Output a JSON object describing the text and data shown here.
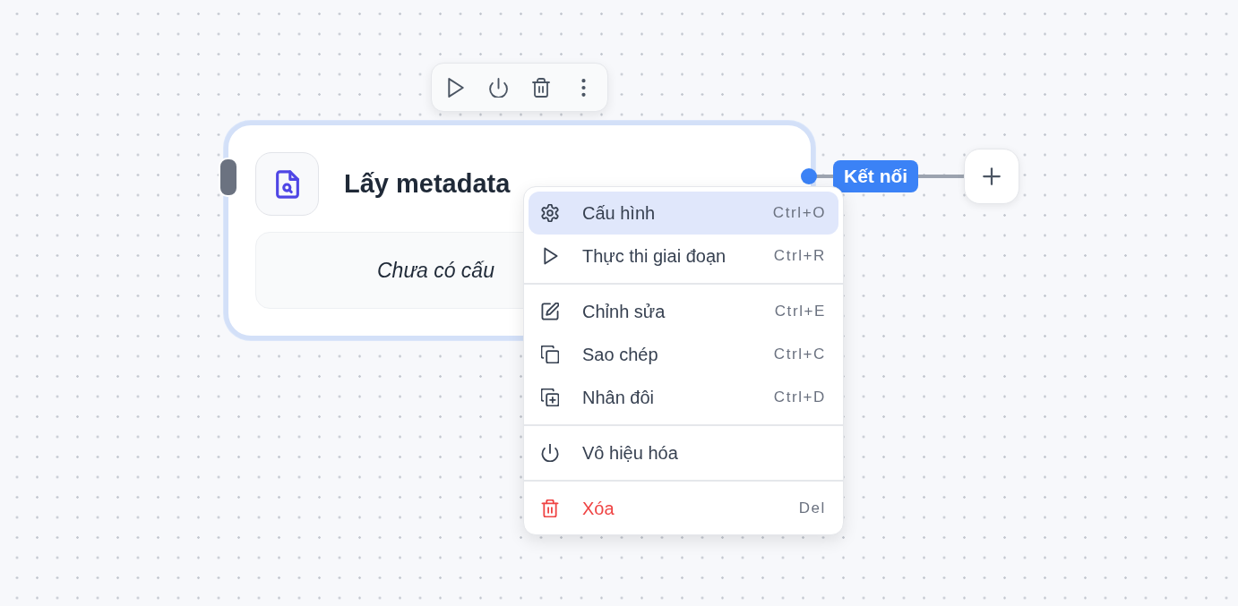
{
  "node": {
    "title": "Lấy metadata",
    "description": "Chưa có cấu",
    "selected": true
  },
  "edge": {
    "label": "Kết nối"
  },
  "context_menu": {
    "groups": [
      {
        "items": [
          {
            "label": "Cấu hình",
            "shortcut": "Ctrl+O",
            "selected": true,
            "danger": false
          },
          {
            "label": "Thực thi giai đoạn",
            "shortcut": "Ctrl+R",
            "selected": false,
            "danger": false
          }
        ]
      },
      {
        "items": [
          {
            "label": "Chỉnh sửa",
            "shortcut": "Ctrl+E",
            "selected": false,
            "danger": false
          },
          {
            "label": "Sao chép",
            "shortcut": "Ctrl+C",
            "selected": false,
            "danger": false
          },
          {
            "label": "Nhân đôi",
            "shortcut": "Ctrl+D",
            "selected": false,
            "danger": false
          }
        ]
      },
      {
        "items": [
          {
            "label": "Vô hiệu hóa",
            "selected": false,
            "danger": false
          }
        ]
      },
      {
        "items": [
          {
            "label": "Xóa",
            "shortcut": "Del",
            "selected": false,
            "danger": true
          }
        ]
      }
    ]
  }
}
